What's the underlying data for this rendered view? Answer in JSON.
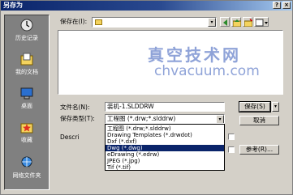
{
  "window": {
    "title": "另存为",
    "help_btn": "?",
    "close_btn": "×"
  },
  "places": [
    {
      "label": "历史记录",
      "icon": "history-icon"
    },
    {
      "label": "我的文档",
      "icon": "my-documents-icon"
    },
    {
      "label": "桌面",
      "icon": "desktop-icon"
    },
    {
      "label": "收藏",
      "icon": "favorites-icon"
    },
    {
      "label": "网络文件夹",
      "icon": "network-folder-icon"
    }
  ],
  "look_in": {
    "label": "保存在(I):",
    "value": "",
    "arrow": "▾"
  },
  "toolbar": {
    "icons": [
      "back-icon",
      "up-folder-icon",
      "new-folder-icon",
      "views-icon"
    ]
  },
  "watermark": {
    "line1": "真空技术网",
    "line2": "chvacuum.com"
  },
  "filename": {
    "label": "文件名(N):",
    "value": "装机-1.SLDDRW"
  },
  "filetype": {
    "label": "保存类型(T):",
    "value": "工程图 (*.drw;*.slddrw)",
    "arrow": "▾",
    "options": [
      "工程图 (*.drw;*.slddrw)",
      "Drawing Templates (*.drwdot)",
      "Dxf (*.dxf)",
      "Dwg (*.dwg)",
      "eDrawing (*.edrw)",
      "JPEG (*.jpg)",
      "Tif (*.tif)"
    ],
    "selected_index": 3
  },
  "description": {
    "label": "Descri"
  },
  "buttons": {
    "save": "保存(S)",
    "save_arrow": "▾",
    "cancel": "取消",
    "options": "参考(R)..."
  }
}
